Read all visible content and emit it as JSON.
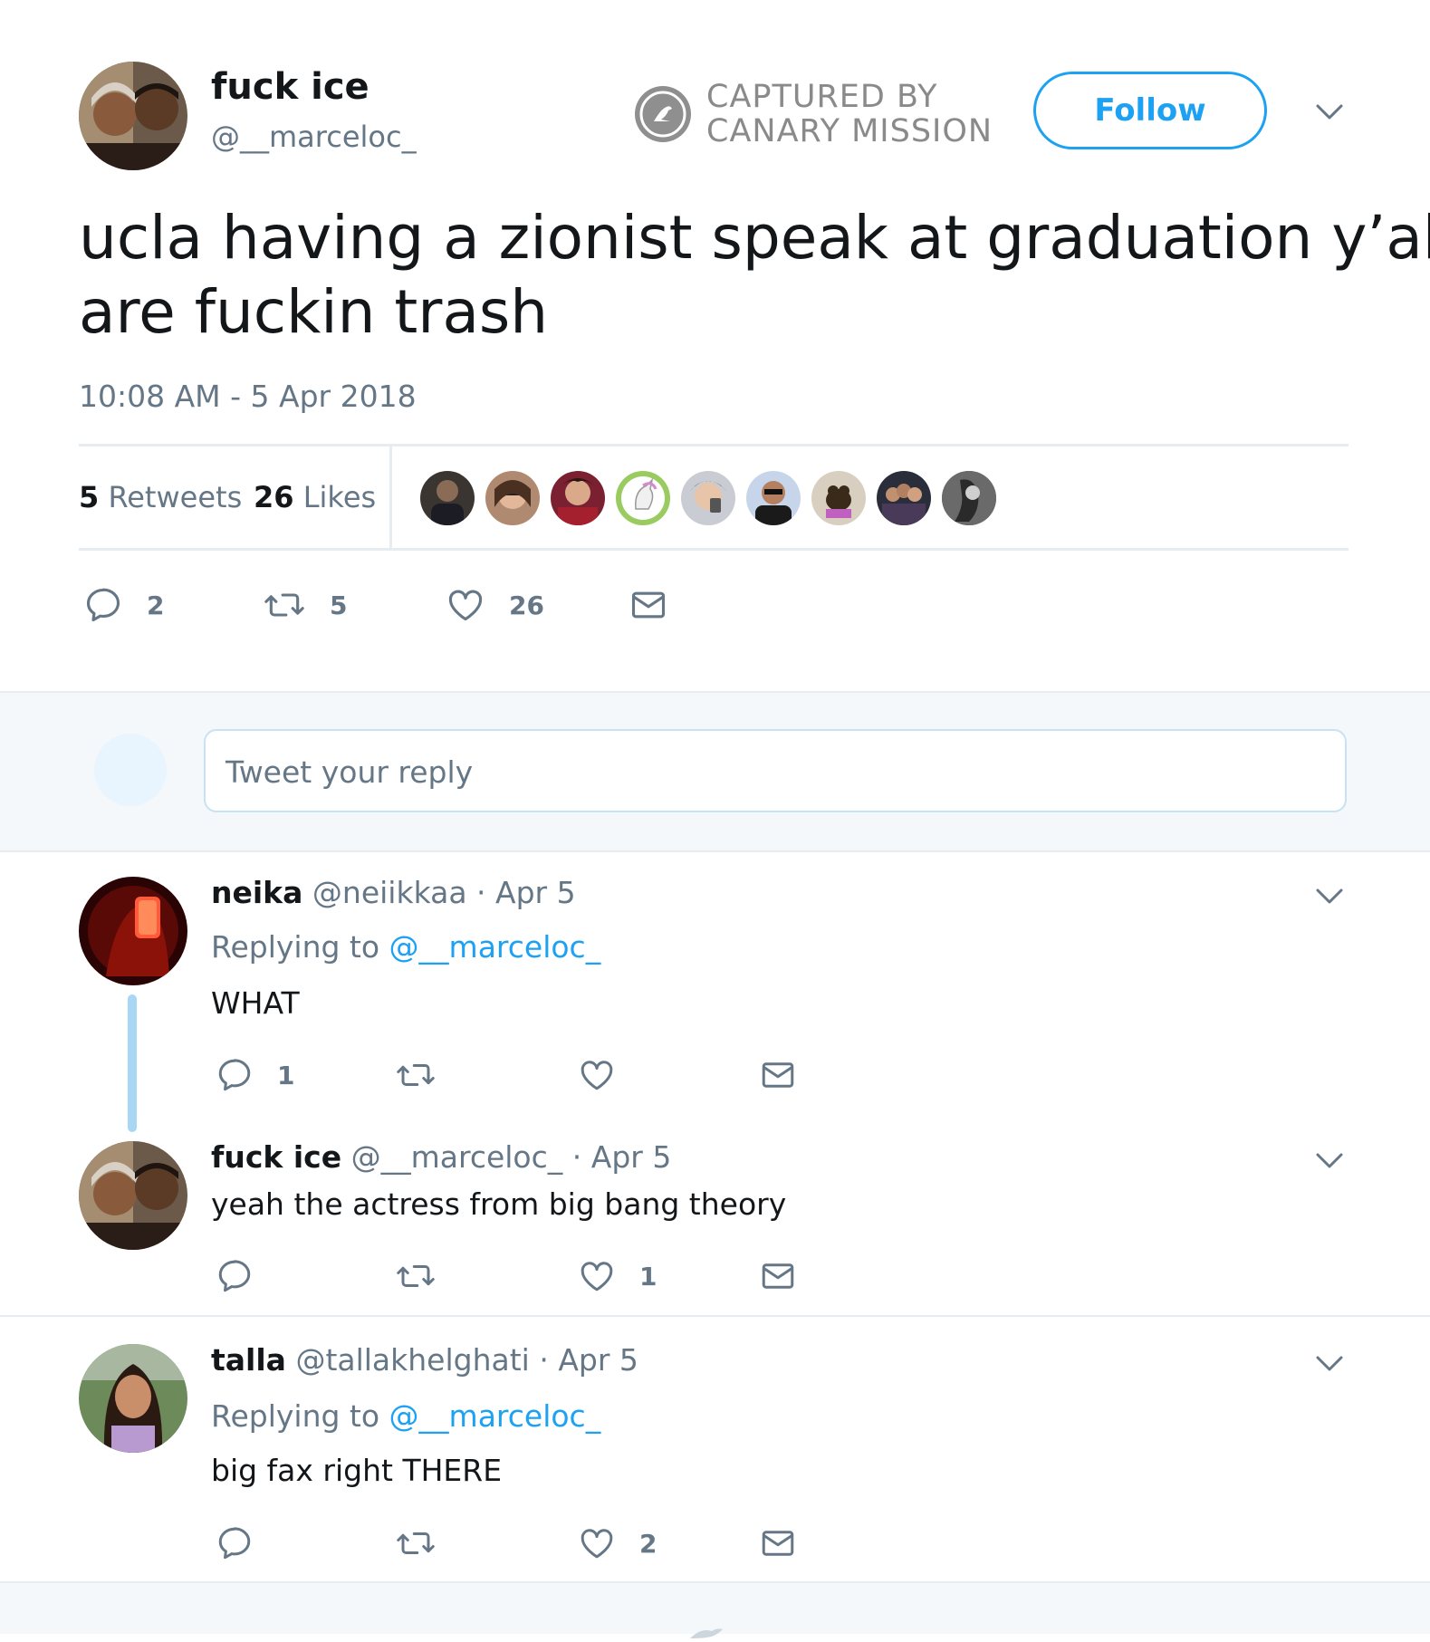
{
  "colors": {
    "accent": "#1da1f2",
    "text": "#14171a",
    "muted": "#657786",
    "border": "#e6ecf0",
    "reply_bg": "#f5f8fa"
  },
  "tweet": {
    "name": "fuck ice",
    "handle": "@__marceloc_",
    "watermark_line1": "CAPTURED BY",
    "watermark_line2": "CANARY MISSION",
    "follow_label": "Follow",
    "text_line1": "ucla having a zionist speak at graduation y’all",
    "text_line2": "are fuckin trash",
    "timestamp": "10:08 AM - 5 Apr 2018",
    "retweets_count": "5",
    "retweets_label": "Retweets",
    "likes_count": "26",
    "likes_label": "Likes",
    "actions": {
      "replies": "2",
      "retweets": "5",
      "likes": "26"
    },
    "liker_avatar_count": 9
  },
  "reply_box": {
    "placeholder": "Tweet your reply"
  },
  "replies": [
    {
      "name": "neika",
      "handle": "@neiikkaa",
      "date": "· Apr 5",
      "replying_prefix": "Replying to",
      "replying_to": "@__marceloc_",
      "text": "WHAT",
      "replies": "1",
      "retweets": "",
      "likes": ""
    },
    {
      "name": "fuck ice",
      "handle": "@__marceloc_",
      "date": "· Apr 5",
      "text": "yeah the actress from big bang theory",
      "replies": "",
      "retweets": "",
      "likes": "1"
    },
    {
      "name": "talla",
      "handle": "@tallakhelghati",
      "date": "· Apr 5",
      "replying_prefix": "Replying to",
      "replying_to": "@__marceloc_",
      "text": "big fax right THERE",
      "replies": "",
      "retweets": "",
      "likes": "2"
    }
  ]
}
